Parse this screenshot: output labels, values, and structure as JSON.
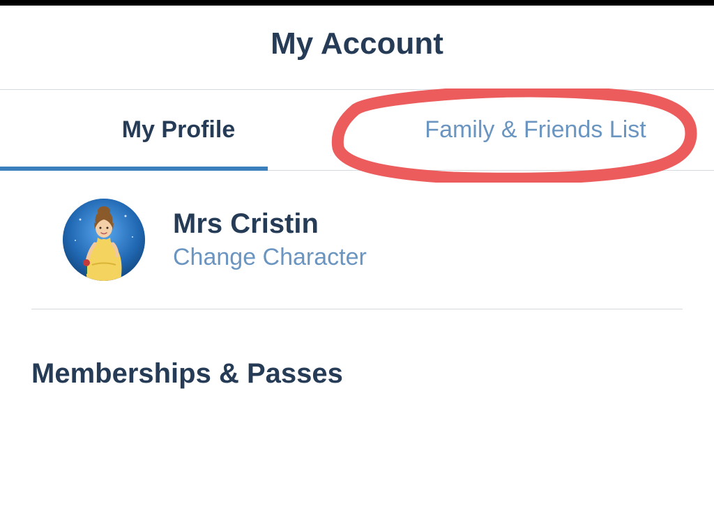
{
  "header": {
    "title": "My Account"
  },
  "tabs": {
    "profile": "My Profile",
    "friends": "Family & Friends List"
  },
  "profile": {
    "name": "Mrs Cristin",
    "changeCharacter": "Change Character"
  },
  "sections": {
    "memberships": "Memberships & Passes"
  }
}
